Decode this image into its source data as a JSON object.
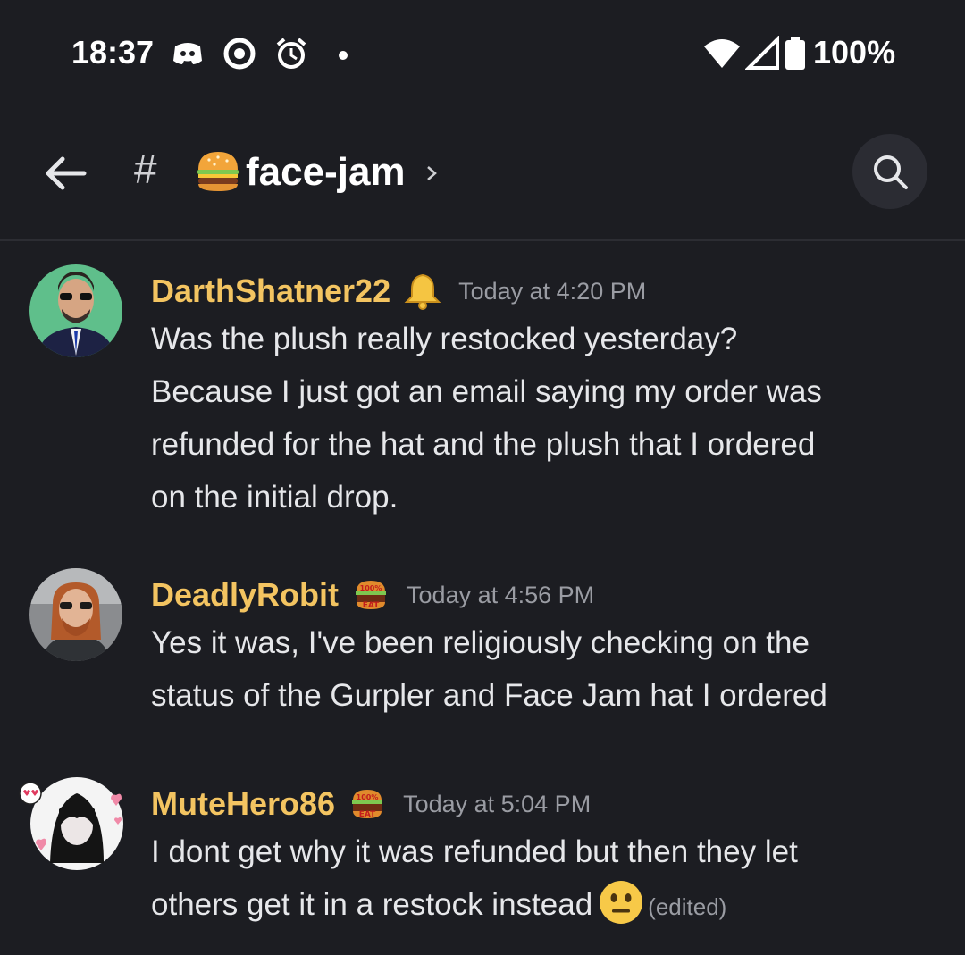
{
  "status_bar": {
    "time": "18:37",
    "icons": [
      "discord-icon",
      "sync-icon",
      "alarm-icon",
      "dot-icon",
      "wifi-icon",
      "signal-icon",
      "battery-icon"
    ],
    "battery": "100%"
  },
  "header": {
    "hash": "#",
    "channel_name": "face-jam",
    "channel_emoji": "burger-icon"
  },
  "messages": [
    {
      "username": "DarthShatner22",
      "badge": "bell-icon",
      "timestamp": "Today at 4:20 PM",
      "lines": [
        "Was the plush really restocked yesterday?",
        "Because I just got an email saying my order was",
        "refunded for the hat and the plush that I ordered",
        "on the initial drop."
      ]
    },
    {
      "username": "DeadlyRobit",
      "badge": "100-eat-burger-icon",
      "timestamp": "Today at 4:56 PM",
      "lines": [
        "Yes it was, I've been religiously checking on the",
        "status of the Gurpler and Face Jam hat I ordered"
      ]
    },
    {
      "username": "MuteHero86",
      "badge": "100-eat-burger-icon",
      "timestamp": "Today at 5:04 PM",
      "lines": [
        "I dont get why it was refunded but then they let",
        "others get it in a restock instead"
      ],
      "edited": "(edited)"
    }
  ],
  "colors": {
    "background": "#1c1d22",
    "username": "#f3c461",
    "timestamp": "#9a9ca3"
  }
}
